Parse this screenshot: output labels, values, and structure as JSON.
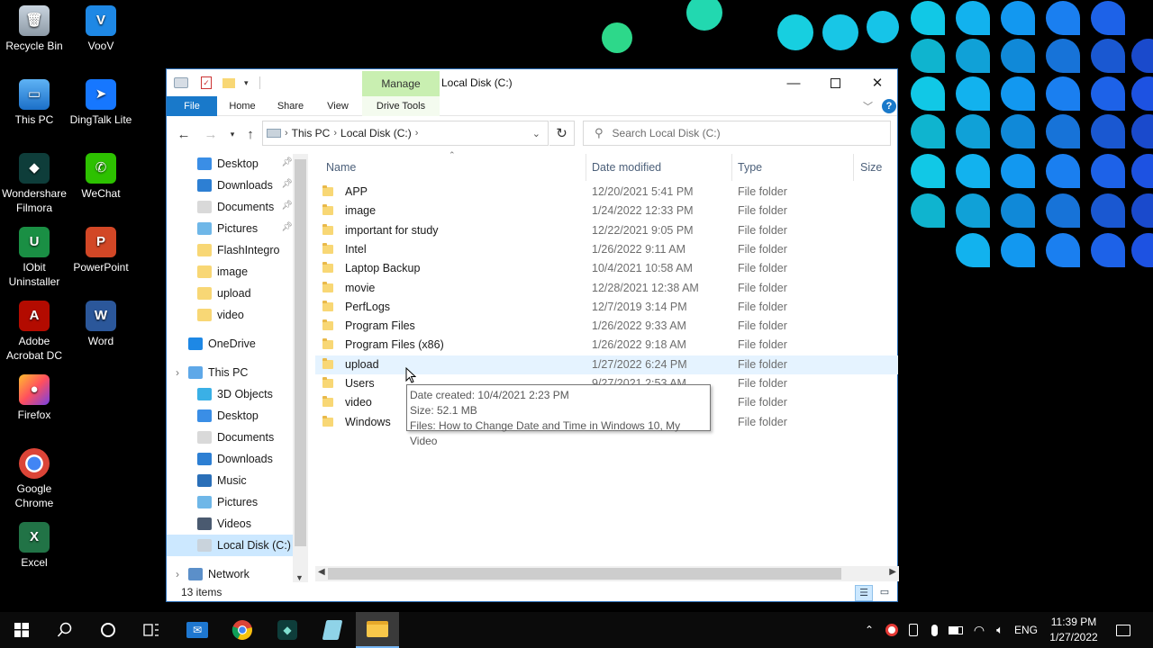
{
  "desktop": {
    "icons": [
      {
        "label1": "Recycle Bin",
        "label2": ""
      },
      {
        "label1": "VooV",
        "label2": ""
      },
      {
        "label1": "This PC",
        "label2": ""
      },
      {
        "label1": "DingTalk Lite",
        "label2": ""
      },
      {
        "label1": "Wondershare",
        "label2": "Filmora"
      },
      {
        "label1": "WeChat",
        "label2": ""
      },
      {
        "label1": "IObit",
        "label2": "Uninstaller"
      },
      {
        "label1": "PowerPoint",
        "label2": ""
      },
      {
        "label1": "Adobe",
        "label2": "Acrobat DC"
      },
      {
        "label1": "Word",
        "label2": ""
      },
      {
        "label1": "Firefox",
        "label2": ""
      },
      {
        "label1": "Google",
        "label2": "Chrome"
      },
      {
        "label1": "Excel",
        "label2": ""
      }
    ]
  },
  "window": {
    "title": "Local Disk (C:)",
    "manage_tab": "Manage",
    "ribbon_tabs": [
      "File",
      "Home",
      "Share",
      "View",
      "Drive Tools"
    ],
    "address": [
      "This PC",
      "Local Disk (C:)"
    ],
    "search_placeholder": "Search Local Disk (C:)",
    "nav": {
      "quick_access": [
        "Desktop",
        "Downloads",
        "Documents",
        "Pictures",
        "FlashIntegro",
        "image",
        "upload",
        "video"
      ],
      "onedrive": "OneDrive",
      "this_pc": "This PC",
      "this_pc_items": [
        "3D Objects",
        "Desktop",
        "Documents",
        "Downloads",
        "Music",
        "Pictures",
        "Videos",
        "Local Disk (C:)"
      ],
      "network": "Network"
    },
    "columns": [
      "Name",
      "Date modified",
      "Type",
      "Size"
    ],
    "files": [
      {
        "name": "APP",
        "date": "12/20/2021 5:41 PM",
        "type": "File folder"
      },
      {
        "name": "image",
        "date": "1/24/2022 12:33 PM",
        "type": "File folder"
      },
      {
        "name": "important for study",
        "date": "12/22/2021 9:05 PM",
        "type": "File folder"
      },
      {
        "name": "Intel",
        "date": "1/26/2022 9:11 AM",
        "type": "File folder"
      },
      {
        "name": "Laptop Backup",
        "date": "10/4/2021 10:58 AM",
        "type": "File folder"
      },
      {
        "name": "movie",
        "date": "12/28/2021 12:38 AM",
        "type": "File folder"
      },
      {
        "name": "PerfLogs",
        "date": "12/7/2019 3:14 PM",
        "type": "File folder"
      },
      {
        "name": "Program Files",
        "date": "1/26/2022 9:33 AM",
        "type": "File folder"
      },
      {
        "name": "Program Files (x86)",
        "date": "1/26/2022 9:18 AM",
        "type": "File folder"
      },
      {
        "name": "upload",
        "date": "1/27/2022 6:24 PM",
        "type": "File folder"
      },
      {
        "name": "Users",
        "date": "9/27/2021 2:53 AM",
        "type": "File folder"
      },
      {
        "name": "video",
        "date": "",
        "type": "File folder"
      },
      {
        "name": "Windows",
        "date": "",
        "type": "File folder"
      }
    ],
    "tooltip": {
      "line1": "Date created: 10/4/2021 2:23 PM",
      "line2": "Size: 52.1 MB",
      "line3": "Files: How to Change Date and Time in Windows 10, My Video"
    },
    "status": "13 items"
  },
  "taskbar": {
    "language": "ENG",
    "time": "11:39 PM",
    "date": "1/27/2022"
  },
  "colors": {
    "accent": "#1979ca",
    "manage_tab": "#c9efb1",
    "selection": "#cce8ff",
    "hover_row": "#e5f3ff"
  }
}
